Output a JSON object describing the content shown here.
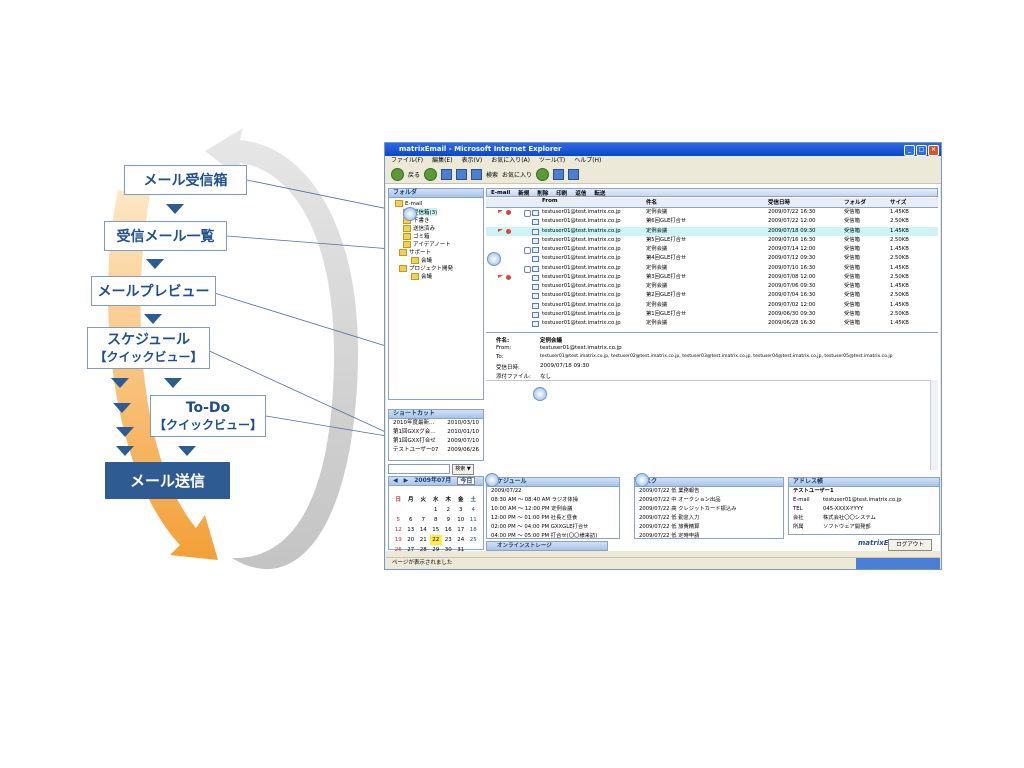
{
  "flow": {
    "inbox": "メール受信箱",
    "list": "受信メール一覧",
    "preview": "メールプレビュー",
    "schedule": "スケジュール",
    "schedule_sub": "【クイックビュー】",
    "todo": "To-Do",
    "todo_sub": "【クイックビュー】",
    "send": "メール送信"
  },
  "colors": {
    "navy": "#2e5c92",
    "box_border": "#7f9bbd",
    "orange": "#f5a13a",
    "gray_arrow": "#cfcfcf"
  },
  "window": {
    "title": "matrixEmail - Microsoft Internet Explorer",
    "menu": [
      "ファイル(F)",
      "編集(E)",
      "表示(V)",
      "お気に入り(A)",
      "ツール(T)",
      "ヘルプ(H)"
    ],
    "toolbar": {
      "back": "戻る",
      "search": "検索",
      "favorites": "お気に入り"
    },
    "status": "ページが表示されました"
  },
  "folders": {
    "header": "フォルダ",
    "items": [
      "E-mail",
      "受信箱(3)",
      "下書き",
      "送信済み",
      "ゴミ箱",
      "アイデアノート",
      "サポート",
      "会議",
      "プロジェクト開発",
      "会議"
    ]
  },
  "shortcut": {
    "header": "ショートカット",
    "items": [
      {
        "label": "2010年度最新…",
        "date": "2010/03/10"
      },
      {
        "label": "第1回GXXグ会…",
        "date": "2010/01/10"
      },
      {
        "label": "第1回GXX打合せ",
        "date": "2009/07/10"
      },
      {
        "label": "テストユーザー07",
        "date": "2009/06/26"
      }
    ]
  },
  "search_button": "検索 ▼",
  "calendar": {
    "month": "2009年07月",
    "today_button": "今日",
    "weekdays": [
      "日",
      "月",
      "火",
      "水",
      "木",
      "金",
      "土"
    ],
    "weeks": [
      [
        "",
        "",
        "",
        "1",
        "2",
        "3",
        "4"
      ],
      [
        "5",
        "6",
        "7",
        "8",
        "9",
        "10",
        "11"
      ],
      [
        "12",
        "13",
        "14",
        "15",
        "16",
        "17",
        "18"
      ],
      [
        "19",
        "20",
        "21",
        "22",
        "23",
        "24",
        "25"
      ],
      [
        "26",
        "27",
        "28",
        "29",
        "30",
        "31",
        ""
      ]
    ]
  },
  "mail_tabs": [
    "E-mail",
    "新規",
    "削除",
    "印刷",
    "返信",
    "転送"
  ],
  "mail_columns": [
    "From",
    "件名",
    "受信日時",
    "フォルダ",
    "サイズ"
  ],
  "mails": [
    {
      "from": "testuser01@test.imatrix.co.jp",
      "subject": "定例会議",
      "date": "2009/07/22 16:30",
      "folder": "受信箱",
      "size": "1.45KB"
    },
    {
      "from": "testuser01@test.imatrix.co.jp",
      "subject": "第6回GLE打合せ",
      "date": "2009/07/22 12:00",
      "folder": "受信箱",
      "size": "2.50KB"
    },
    {
      "from": "testuser01@test.imatrix.co.jp",
      "subject": "定例会議",
      "date": "2009/07/18 09:30",
      "folder": "受信箱",
      "size": "1.45KB"
    },
    {
      "from": "testuser01@test.imatrix.co.jp",
      "subject": "第5回GLE打合せ",
      "date": "2009/07/16 16:30",
      "folder": "受信箱",
      "size": "2.50KB"
    },
    {
      "from": "testuser01@test.imatrix.co.jp",
      "subject": "定例会議",
      "date": "2009/07/14 12:00",
      "folder": "受信箱",
      "size": "1.45KB"
    },
    {
      "from": "testuser01@test.imatrix.co.jp",
      "subject": "第4回GLE打合せ",
      "date": "2009/07/12 09:30",
      "folder": "受信箱",
      "size": "2.50KB"
    },
    {
      "from": "testuser01@test.imatrix.co.jp",
      "subject": "定例会議",
      "date": "2009/07/10 16:30",
      "folder": "受信箱",
      "size": "1.45KB"
    },
    {
      "from": "testuser01@test.imatrix.co.jp",
      "subject": "第3回GLE打合せ",
      "date": "2009/07/08 12:00",
      "folder": "受信箱",
      "size": "2.50KB"
    },
    {
      "from": "testuser01@test.imatrix.co.jp",
      "subject": "定例会議",
      "date": "2009/07/06 09:30",
      "folder": "受信箱",
      "size": "1.45KB"
    },
    {
      "from": "testuser01@test.imatrix.co.jp",
      "subject": "第2回GLE打合せ",
      "date": "2009/07/04 16:30",
      "folder": "受信箱",
      "size": "2.50KB"
    },
    {
      "from": "testuser01@test.imatrix.co.jp",
      "subject": "定例会議",
      "date": "2009/07/02 12:00",
      "folder": "受信箱",
      "size": "1.45KB"
    },
    {
      "from": "testuser01@test.imatrix.co.jp",
      "subject": "第1回GLE打合せ",
      "date": "2009/06/30 09:30",
      "folder": "受信箱",
      "size": "2.50KB"
    },
    {
      "from": "testuser01@test.imatrix.co.jp",
      "subject": "定例会議",
      "date": "2009/06/28 16:30",
      "folder": "受信箱",
      "size": "1.45KB"
    }
  ],
  "preview": {
    "subject_label": "件名:",
    "subject": "定例会議",
    "from_label": "From:",
    "from": "testuser01@test.imatrix.co.jp",
    "to_label": "To:",
    "to": "testuser01@test.imatrix.co.jp, testuser02@test.imatrix.co.jp, testuser03@test.imatrix.co.jp, testuser04@test.imatrix.co.jp, testuser05@test.imatrix.co.jp",
    "date_label": "受信日時:",
    "date": "2009/07/18 09:30",
    "attach_label": "添付ファイル:",
    "attach": "なし"
  },
  "schedule_pane": {
    "header": "スケジュール",
    "date": "2009/07/22",
    "rows": [
      "08:30 AM 〜 08:40 AM ラジオ体操",
      "10:00 AM 〜 12:00 PM 定例会議",
      "12:00 PM 〜 01:00 PM 社長と昼食",
      "02:00 PM 〜 04:00 PM GXXGLE打合せ",
      "04:00 PM 〜 05:00 PM 打合せ(〇〇様来訪)"
    ]
  },
  "task_pane": {
    "header": "タスク",
    "rows": [
      "2009/07/22 低 業務報告",
      "2009/07/22 中 オークション出品",
      "2009/07/22 高 クレジットカード振込み",
      "2009/07/22 低 勤怠入力",
      "2009/07/22 低 旅費精算",
      "2009/07/22 低 定時申請"
    ]
  },
  "address_pane": {
    "header": "アドレス帳",
    "name": "テストユーザー1",
    "rows": [
      {
        "label": "E-mail",
        "value": "testuser01@test.imatrix.co.jp"
      },
      {
        "label": "TEL",
        "value": "045-XXXX-YYYY"
      },
      {
        "label": "会社",
        "value": "株式会社〇〇システム"
      },
      {
        "label": "所属",
        "value": "ソフトウェア開発部"
      }
    ]
  },
  "storage_label": "オンラインストレージ",
  "logo": "matrixEmail",
  "logout": "ログアウト"
}
